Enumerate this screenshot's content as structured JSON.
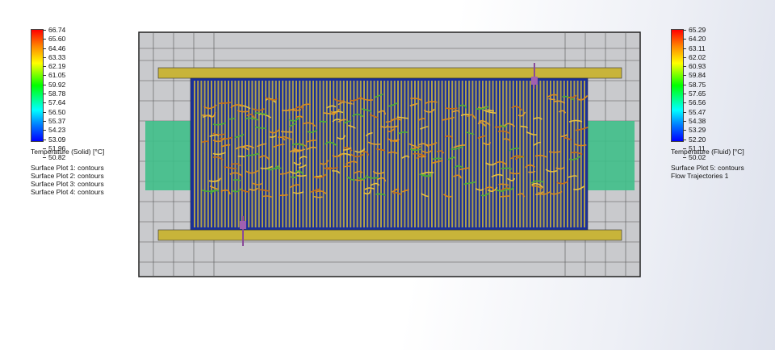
{
  "legend_solid": {
    "ticks": [
      "66.74",
      "65.60",
      "64.46",
      "63.33",
      "62.19",
      "61.05",
      "59.92",
      "58.78",
      "57.64",
      "56.50",
      "55.37",
      "54.23",
      "53.09",
      "51.96",
      "50.82"
    ],
    "caption": "Temperature (Solid) [°C]",
    "plots": [
      "Surface Plot 1: contours",
      "Surface Plot 2: contours",
      "Surface Plot 3: contours",
      "Surface Plot 4: contours"
    ]
  },
  "legend_fluid": {
    "ticks": [
      "65.29",
      "64.20",
      "63.11",
      "62.02",
      "60.93",
      "59.84",
      "58.75",
      "57.65",
      "56.56",
      "55.47",
      "54.38",
      "53.29",
      "52.20",
      "51.11",
      "50.02"
    ],
    "caption": "Temperature (Fluid) [°C]",
    "plots": [
      "Surface Plot 5: contours",
      "Flow Trajectories 1"
    ]
  }
}
